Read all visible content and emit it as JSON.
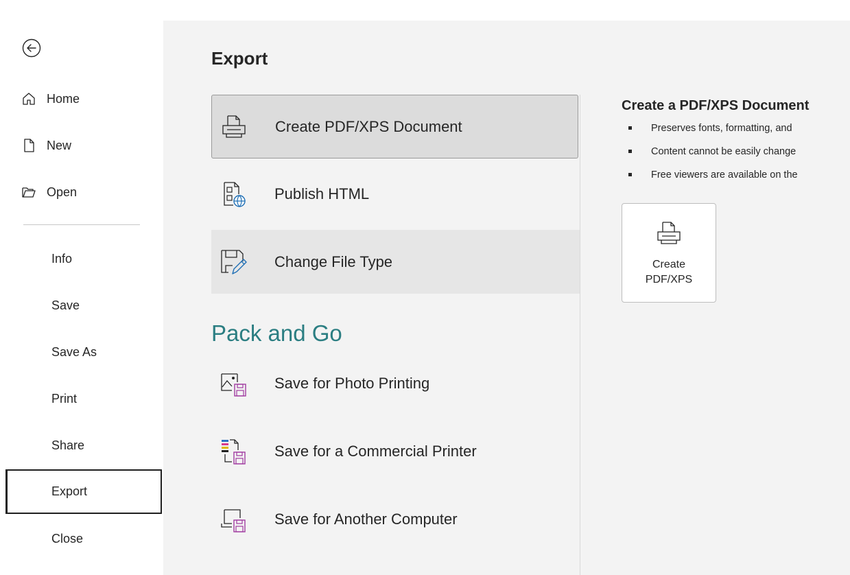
{
  "nav": {
    "back_label": "",
    "items": [
      {
        "id": "home",
        "label": "Home"
      },
      {
        "id": "new",
        "label": "New"
      },
      {
        "id": "open",
        "label": "Open"
      },
      {
        "id": "info",
        "label": "Info"
      },
      {
        "id": "save",
        "label": "Save"
      },
      {
        "id": "save-as",
        "label": "Save As"
      },
      {
        "id": "print",
        "label": "Print"
      },
      {
        "id": "share",
        "label": "Share"
      },
      {
        "id": "export",
        "label": "Export"
      },
      {
        "id": "close",
        "label": "Close"
      }
    ],
    "selected": "export"
  },
  "main": {
    "title": "Export",
    "options": [
      {
        "label": "Create PDF/XPS Document",
        "icon": "pdf-document-icon"
      },
      {
        "label": "Publish HTML",
        "icon": "publish-html-icon"
      },
      {
        "label": "Change File Type",
        "icon": "change-file-type-icon"
      }
    ],
    "pack_and_go": {
      "title": "Pack and Go",
      "options": [
        {
          "label": "Save for Photo Printing",
          "icon": "photo-printing-icon"
        },
        {
          "label": "Save for a Commercial Printer",
          "icon": "commercial-printer-icon"
        },
        {
          "label": "Save for Another Computer",
          "icon": "another-computer-icon"
        }
      ]
    },
    "detail": {
      "title": "Create a PDF/XPS Document",
      "bullets": [
        "Preserves fonts, formatting, and",
        "Content cannot be easily change",
        "Free viewers are available on the"
      ],
      "button_label": "Create\nPDF/XPS"
    }
  },
  "colors": {
    "accent_section": "#2b7e82",
    "main_background": "#f3f3f3",
    "selected_option": "#dcdcdc",
    "icon_purple": "#a03aa0"
  }
}
